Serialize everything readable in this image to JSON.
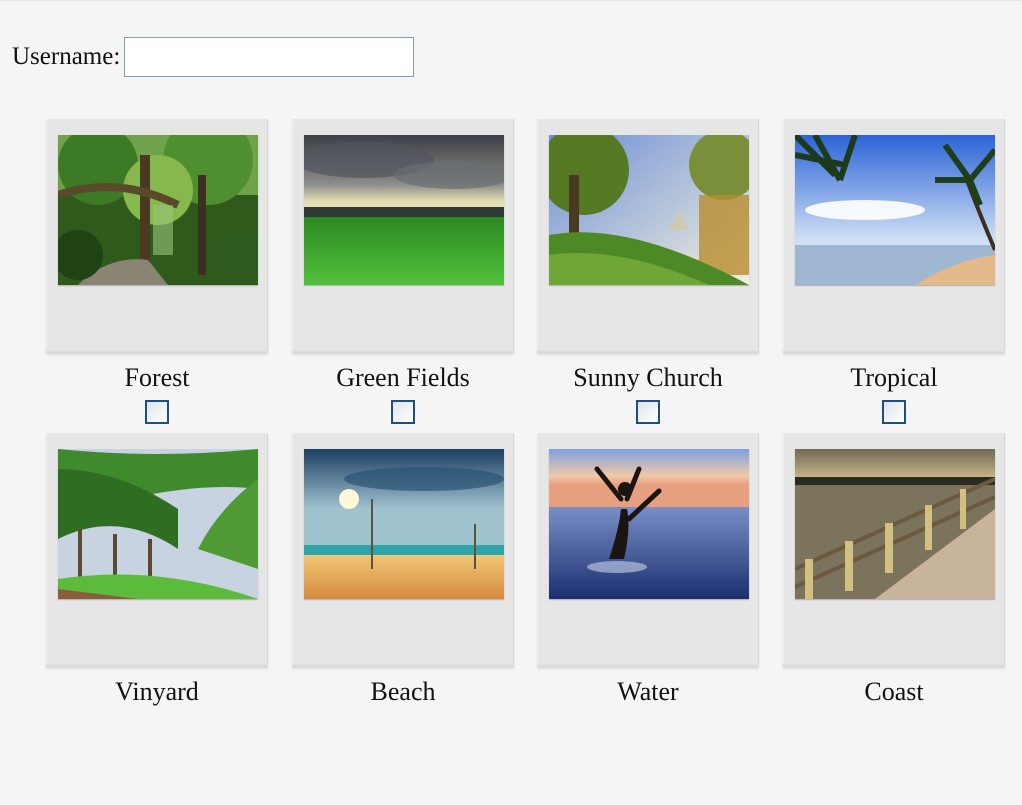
{
  "form": {
    "username_label": "Username:",
    "username_value": "",
    "username_placeholder": ""
  },
  "photos": [
    {
      "caption": "Forest",
      "has_checkbox": true,
      "checked": false,
      "icon": "forest-photo"
    },
    {
      "caption": "Green Fields",
      "has_checkbox": true,
      "checked": false,
      "icon": "green-fields-photo"
    },
    {
      "caption": "Sunny Church",
      "has_checkbox": true,
      "checked": false,
      "icon": "sunny-church-photo"
    },
    {
      "caption": "Tropical",
      "has_checkbox": true,
      "checked": false,
      "icon": "tropical-photo"
    },
    {
      "caption": "Vinyard",
      "has_checkbox": false,
      "checked": false,
      "icon": "vinyard-photo"
    },
    {
      "caption": "Beach",
      "has_checkbox": false,
      "checked": false,
      "icon": "beach-photo"
    },
    {
      "caption": "Water",
      "has_checkbox": false,
      "checked": false,
      "icon": "water-photo"
    },
    {
      "caption": "Coast",
      "has_checkbox": false,
      "checked": false,
      "icon": "coast-photo"
    }
  ],
  "colors": {
    "background": "#f5f5f5",
    "frame": "#e6e6e6",
    "checkbox_border": "#1e4f84",
    "input_border": "#7f9db9"
  }
}
